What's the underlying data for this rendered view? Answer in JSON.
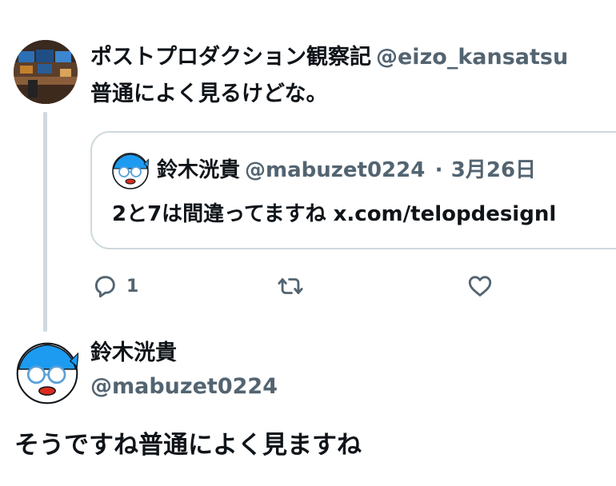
{
  "original_tweet": {
    "display_name": "ポストプロダクション観察記",
    "handle": "@eizo_kansatsu",
    "text": "普通によく見るけどな。"
  },
  "quoted_tweet": {
    "display_name": "鈴木洸貴",
    "handle": "@mabuzet0224",
    "separator": "·",
    "date": "3月26日",
    "text": "2と7は間違ってますね x.com/telopdesignl"
  },
  "actions": {
    "reply_icon": "reply-icon",
    "reply_count": "1",
    "retweet_icon": "retweet-icon",
    "like_icon": "heart-icon"
  },
  "reply_tweet": {
    "display_name": "鈴木洸貴",
    "handle": "@mabuzet0224",
    "text": "そうですね普通によく見ますね"
  },
  "colors": {
    "text": "#0f1419",
    "secondary": "#536471",
    "border": "#cfd9de",
    "avatar_bandana": "#1d9bf0"
  }
}
